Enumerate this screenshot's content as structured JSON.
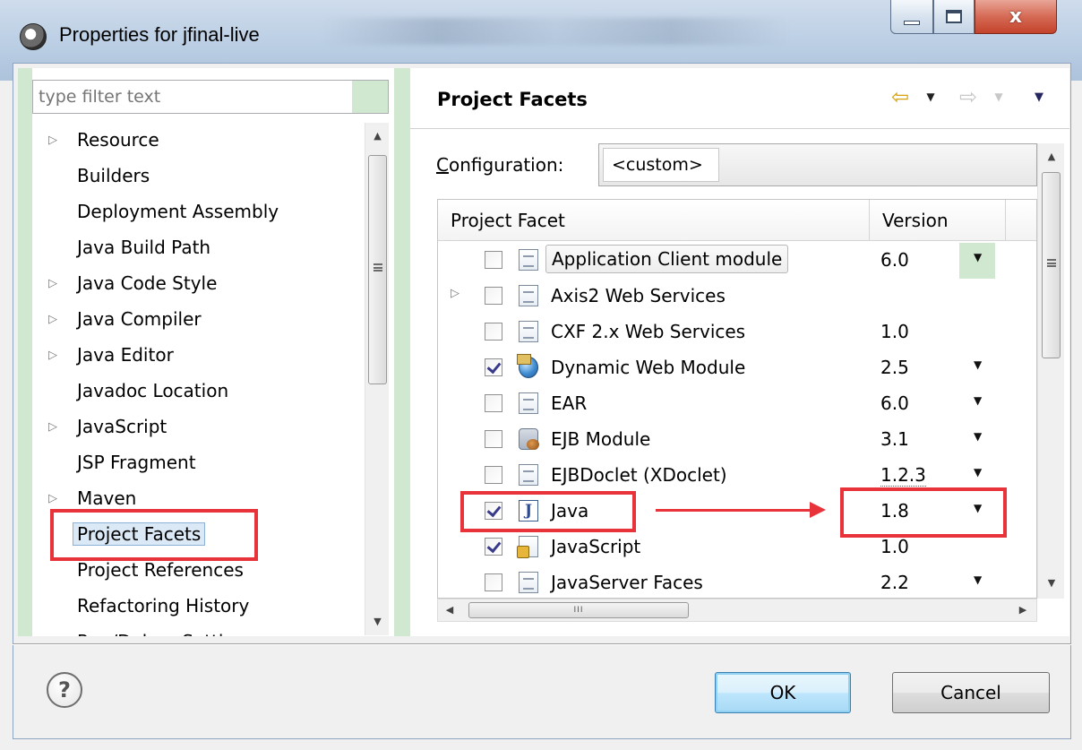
{
  "window": {
    "title": "Properties for jfinal-live",
    "close_glyph": "x"
  },
  "filter": {
    "placeholder": "type filter text"
  },
  "tree": {
    "items": [
      {
        "label": "Resource",
        "expandable": true
      },
      {
        "label": "Builders",
        "expandable": false
      },
      {
        "label": "Deployment Assembly",
        "expandable": false
      },
      {
        "label": "Java Build Path",
        "expandable": false
      },
      {
        "label": "Java Code Style",
        "expandable": true
      },
      {
        "label": "Java Compiler",
        "expandable": true
      },
      {
        "label": "Java Editor",
        "expandable": true
      },
      {
        "label": "Javadoc Location",
        "expandable": false
      },
      {
        "label": "JavaScript",
        "expandable": true
      },
      {
        "label": "JSP Fragment",
        "expandable": false
      },
      {
        "label": "Maven",
        "expandable": true
      },
      {
        "label": "Project Facets",
        "expandable": false,
        "selected": true
      },
      {
        "label": "Project References",
        "expandable": false
      },
      {
        "label": "Refactoring History",
        "expandable": false
      },
      {
        "label": "Run/Debug Settings",
        "expandable": false
      }
    ]
  },
  "page": {
    "title": "Project Facets",
    "config_label_mnemonic": "C",
    "config_label_rest": "onfiguration:",
    "config_value": "<custom>"
  },
  "table": {
    "col_facet": "Project Facet",
    "col_version": "Version",
    "hscroll_grip": "III",
    "rows": [
      {
        "name": "Application Client module",
        "version": "6.0",
        "checked": false,
        "icon": "doc-icon",
        "dropdown": true
      },
      {
        "name": "Axis2 Web Services",
        "version": "",
        "checked": false,
        "icon": "doc-icon",
        "dropdown": false,
        "expandable": true
      },
      {
        "name": "CXF 2.x Web Services",
        "version": "1.0",
        "checked": false,
        "icon": "doc-icon",
        "dropdown": false
      },
      {
        "name": "Dynamic Web Module",
        "version": "2.5",
        "checked": true,
        "icon": "globe-icon",
        "dropdown": true
      },
      {
        "name": "EAR",
        "version": "6.0",
        "checked": false,
        "icon": "doc-icon",
        "dropdown": true
      },
      {
        "name": "EJB Module",
        "version": "3.1",
        "checked": false,
        "icon": "bean-icon",
        "dropdown": true
      },
      {
        "name": "EJBDoclet (XDoclet)",
        "version": "1.2.3",
        "checked": false,
        "icon": "doc-icon",
        "dropdown": true
      },
      {
        "name": "Java",
        "version": "1.8",
        "checked": true,
        "icon": "java-icon",
        "dropdown": true
      },
      {
        "name": "JavaScript",
        "version": "1.0",
        "checked": true,
        "icon": "js-icon",
        "dropdown": false
      },
      {
        "name": "JavaServer Faces",
        "version": "2.2",
        "checked": false,
        "icon": "doc-icon",
        "dropdown": true
      }
    ]
  },
  "java_icon_letter": "J",
  "buttons": {
    "help": "?",
    "ok": "OK",
    "cancel": "Cancel"
  },
  "colors": {
    "annotation": "#e8333b",
    "selection": "#dbe9f6",
    "accent_green": "#cfe8cf"
  }
}
